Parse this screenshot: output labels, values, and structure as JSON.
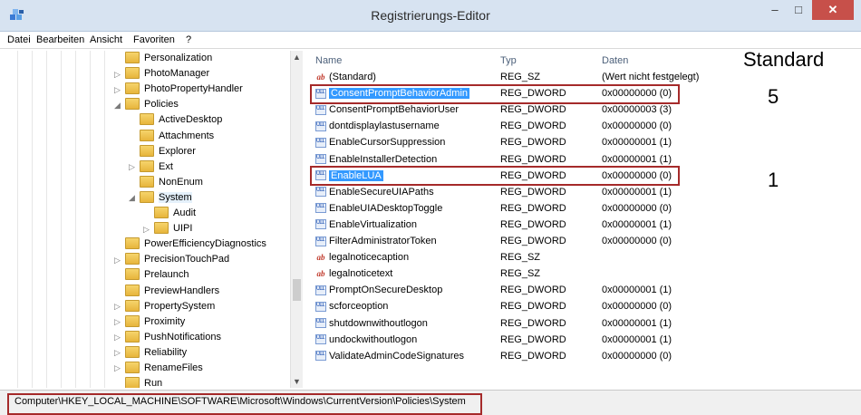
{
  "window": {
    "title": "Registrierungs-Editor",
    "minimize": "–",
    "maximize": "□",
    "close": "✕"
  },
  "menu": [
    "Datei",
    "Bearbeiten",
    "Ansicht",
    "Favoriten",
    "?"
  ],
  "tree": [
    {
      "label": "Personalization",
      "arrow": ""
    },
    {
      "label": "PhotoManager",
      "arrow": "▷"
    },
    {
      "label": "PhotoPropertyHandler",
      "arrow": "▷"
    },
    {
      "label": "Policies",
      "arrow": "◢"
    },
    {
      "label": "ActiveDesktop",
      "arrow": ""
    },
    {
      "label": "Attachments",
      "arrow": ""
    },
    {
      "label": "Explorer",
      "arrow": ""
    },
    {
      "label": "Ext",
      "arrow": "▷"
    },
    {
      "label": "NonEnum",
      "arrow": ""
    },
    {
      "label": "System",
      "arrow": "◢"
    },
    {
      "label": "Audit",
      "arrow": ""
    },
    {
      "label": "UIPI",
      "arrow": "▷"
    },
    {
      "label": "PowerEfficiencyDiagnostics",
      "arrow": ""
    },
    {
      "label": "PrecisionTouchPad",
      "arrow": "▷"
    },
    {
      "label": "Prelaunch",
      "arrow": ""
    },
    {
      "label": "PreviewHandlers",
      "arrow": ""
    },
    {
      "label": "PropertySystem",
      "arrow": "▷"
    },
    {
      "label": "Proximity",
      "arrow": "▷"
    },
    {
      "label": "PushNotifications",
      "arrow": "▷"
    },
    {
      "label": "Reliability",
      "arrow": "▷"
    },
    {
      "label": "RenameFiles",
      "arrow": "▷"
    },
    {
      "label": "Run",
      "arrow": ""
    }
  ],
  "columns": {
    "name": "Name",
    "type": "Typ",
    "data": "Daten"
  },
  "values": [
    {
      "name": "(Standard)",
      "type": "REG_SZ",
      "data": "(Wert nicht festgelegt)",
      "icon": "string-value-icon"
    },
    {
      "name": "ConsentPromptBehaviorAdmin",
      "type": "REG_DWORD",
      "data": "0x00000000 (0)",
      "icon": "dword-value-icon"
    },
    {
      "name": "ConsentPromptBehaviorUser",
      "type": "REG_DWORD",
      "data": "0x00000003 (3)",
      "icon": "dword-value-icon"
    },
    {
      "name": "dontdisplaylastusername",
      "type": "REG_DWORD",
      "data": "0x00000000 (0)",
      "icon": "dword-value-icon"
    },
    {
      "name": "EnableCursorSuppression",
      "type": "REG_DWORD",
      "data": "0x00000001 (1)",
      "icon": "dword-value-icon"
    },
    {
      "name": "EnableInstallerDetection",
      "type": "REG_DWORD",
      "data": "0x00000001 (1)",
      "icon": "dword-value-icon"
    },
    {
      "name": "EnableLUA",
      "type": "REG_DWORD",
      "data": "0x00000000 (0)",
      "icon": "dword-value-icon"
    },
    {
      "name": "EnableSecureUIAPaths",
      "type": "REG_DWORD",
      "data": "0x00000001 (1)",
      "icon": "dword-value-icon"
    },
    {
      "name": "EnableUIADesktopToggle",
      "type": "REG_DWORD",
      "data": "0x00000000 (0)",
      "icon": "dword-value-icon"
    },
    {
      "name": "EnableVirtualization",
      "type": "REG_DWORD",
      "data": "0x00000001 (1)",
      "icon": "dword-value-icon"
    },
    {
      "name": "FilterAdministratorToken",
      "type": "REG_DWORD",
      "data": "0x00000000 (0)",
      "icon": "dword-value-icon"
    },
    {
      "name": "legalnoticecaption",
      "type": "REG_SZ",
      "data": "",
      "icon": "string-value-icon"
    },
    {
      "name": "legalnoticetext",
      "type": "REG_SZ",
      "data": "",
      "icon": "string-value-icon"
    },
    {
      "name": "PromptOnSecureDesktop",
      "type": "REG_DWORD",
      "data": "0x00000001 (1)",
      "icon": "dword-value-icon"
    },
    {
      "name": "scforceoption",
      "type": "REG_DWORD",
      "data": "0x00000000 (0)",
      "icon": "dword-value-icon"
    },
    {
      "name": "shutdownwithoutlogon",
      "type": "REG_DWORD",
      "data": "0x00000001 (1)",
      "icon": "dword-value-icon"
    },
    {
      "name": "undockwithoutlogon",
      "type": "REG_DWORD",
      "data": "0x00000001 (1)",
      "icon": "dword-value-icon"
    },
    {
      "name": "ValidateAdminCodeSignatures",
      "type": "REG_DWORD",
      "data": "0x00000000 (0)",
      "icon": "dword-value-icon"
    }
  ],
  "annotations": {
    "standard": "Standard",
    "admin_default": "5",
    "lua_default": "1"
  },
  "status": {
    "path": "Computer\\HKEY_LOCAL_MACHINE\\SOFTWARE\\Microsoft\\Windows\\CurrentVersion\\Policies\\System"
  },
  "colors": {
    "highlight_box": "#a52a2a",
    "selection": "#3399ff",
    "close_button": "#c7504a"
  }
}
